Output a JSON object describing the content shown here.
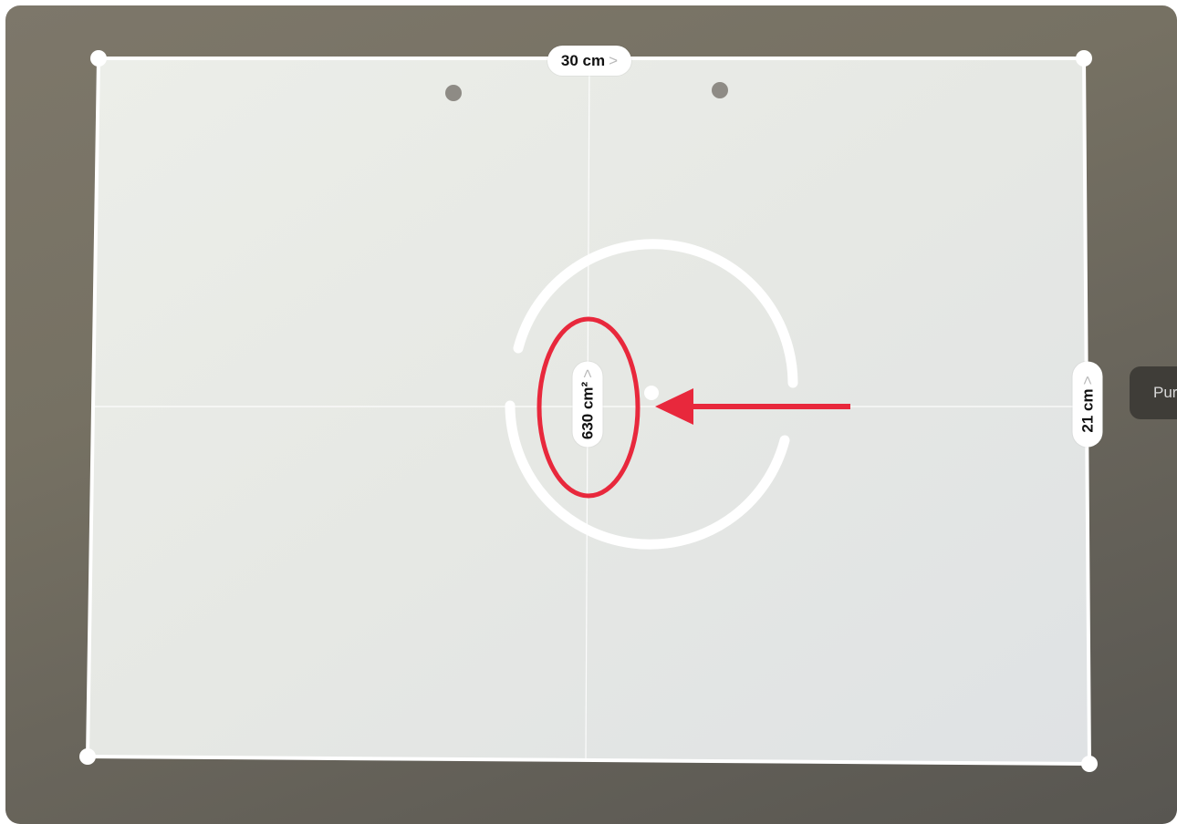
{
  "measure": {
    "top_edge_label": "30 cm",
    "side_edge_label": "21 cm",
    "area_label": "630 cm²",
    "chevron": ">"
  },
  "side_button": {
    "label": "Pur"
  },
  "colors": {
    "annotation_red": "#e8283c",
    "overlay_white": "#ffffff",
    "paper": "#e8eae6"
  },
  "icons": {
    "chevron": "chevron-right-icon",
    "handle": "corner-handle-dot",
    "reticle": "reticle-ring",
    "arrow": "left-arrow-annotation"
  }
}
